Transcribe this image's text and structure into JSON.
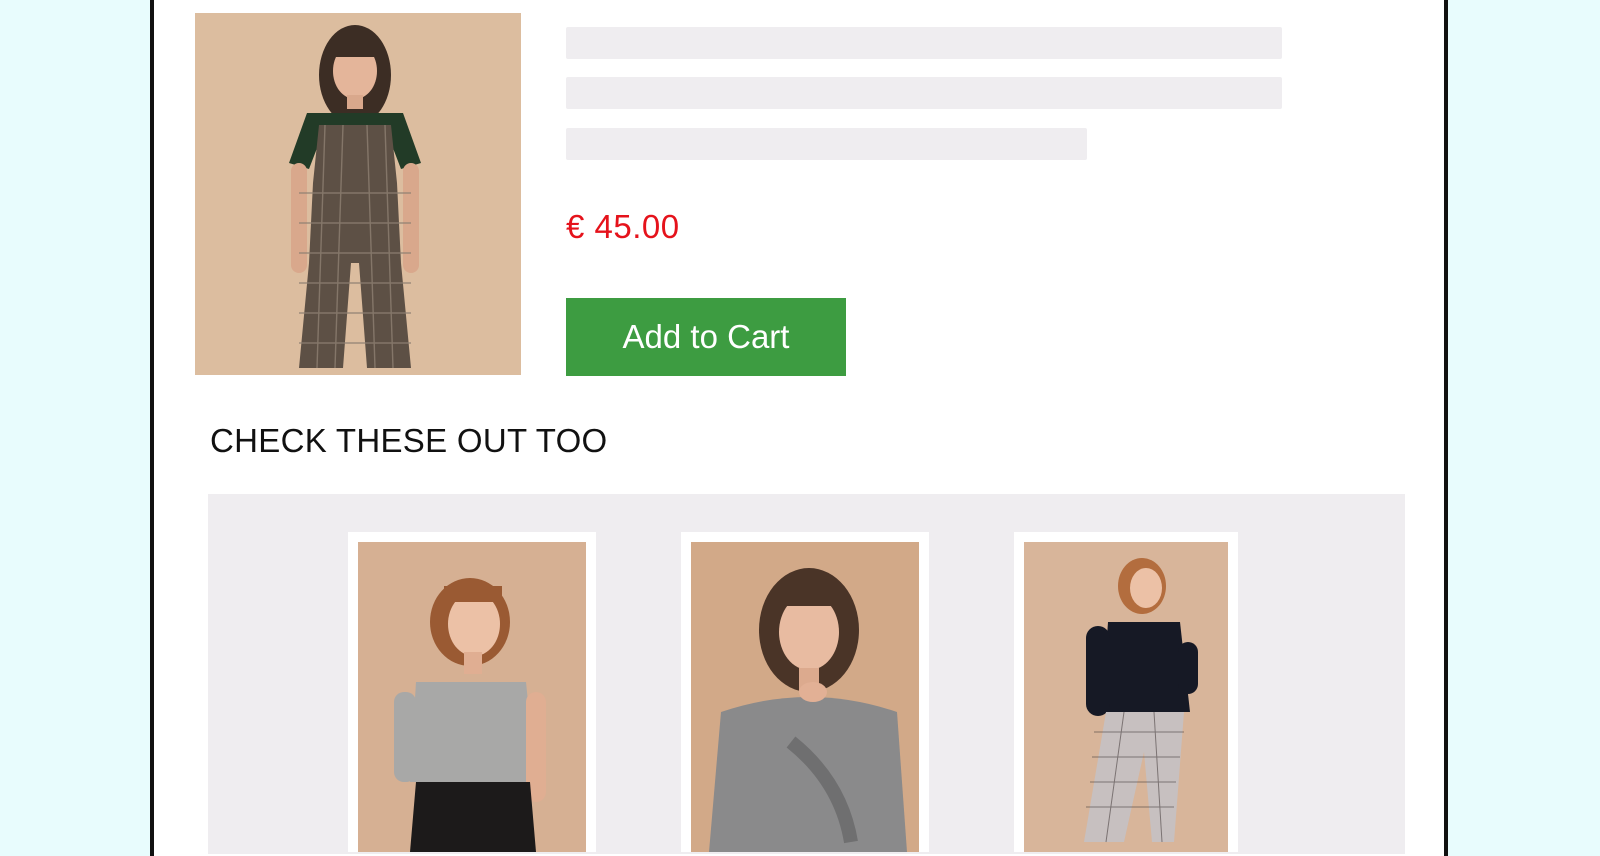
{
  "product": {
    "image_alt": "Woman in plaid dungarees",
    "price": "€ 45.00",
    "add_to_cart_label": "Add to Cart"
  },
  "recommendations": {
    "title": "CHECK THESE OUT TOO",
    "items": [
      {
        "image_alt": "Woman in grey ribbed top"
      },
      {
        "image_alt": "Woman in grey sweatshirt"
      },
      {
        "image_alt": "Woman in black fluffy sweater and check trousers"
      }
    ]
  },
  "colors": {
    "background": "#e8fcfd",
    "price": "#e5121b",
    "cart_button": "#3d9c41",
    "skeleton": "#efedf0"
  }
}
